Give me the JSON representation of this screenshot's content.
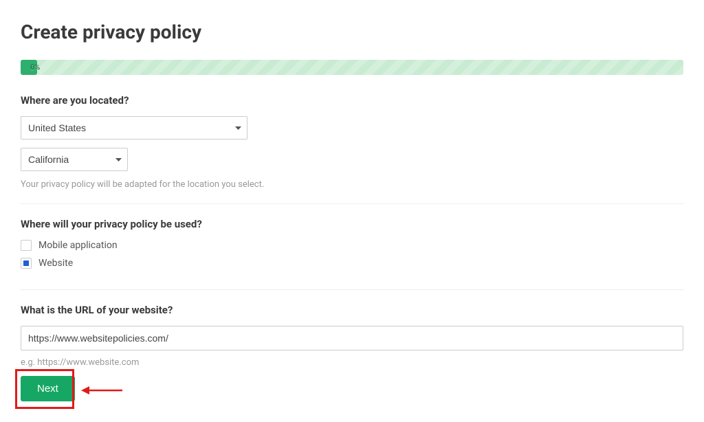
{
  "page": {
    "title": "Create privacy policy"
  },
  "progress": {
    "percent_label": "0%"
  },
  "location": {
    "heading": "Where are you located?",
    "country_value": "United States",
    "state_value": "California",
    "helper": "Your privacy policy will be adapted for the location you select."
  },
  "usage": {
    "heading": "Where will your privacy policy be used?",
    "options": [
      {
        "label": "Mobile application",
        "checked": false
      },
      {
        "label": "Website",
        "checked": true
      }
    ]
  },
  "url": {
    "heading": "What is the URL of your website?",
    "value": "https://www.websitepolicies.com/",
    "example": "e.g. https://www.website.com"
  },
  "buttons": {
    "next_label": "Next"
  }
}
